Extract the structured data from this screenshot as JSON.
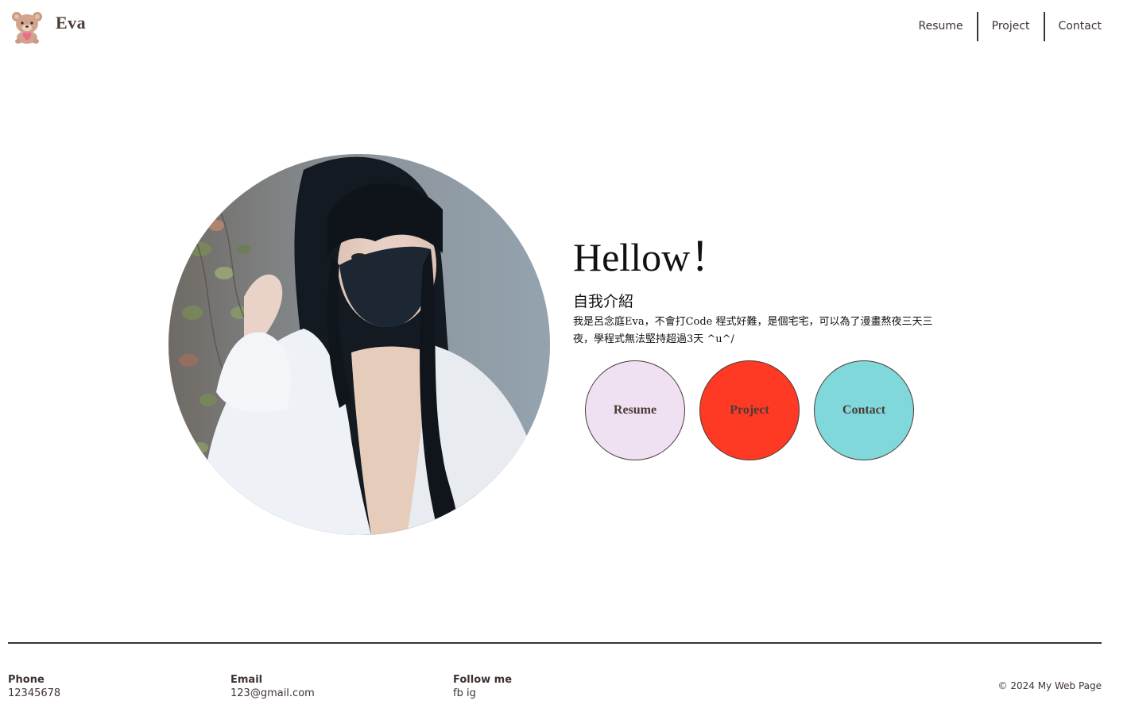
{
  "header": {
    "brand": "Eva",
    "logo_icon": "teddy-bear-icon",
    "nav": [
      {
        "label": "Resume"
      },
      {
        "label": "Project"
      },
      {
        "label": "Contact"
      }
    ]
  },
  "hero": {
    "photo_icon": "profile-photo",
    "greeting": "Hellow！",
    "intro_title": "自我介紹",
    "intro_text": "我是呂念庭Eva，不會打Code 程式好難，是個宅宅，可以為了漫畫熬夜三天三夜，學程式無法堅持超過3天 ^u^/",
    "buttons": [
      {
        "label": "Resume",
        "color": "#efe1f2"
      },
      {
        "label": "Project",
        "color": "#ff3a24"
      },
      {
        "label": "Contact",
        "color": "#80d8da"
      }
    ]
  },
  "footer": {
    "phone_label": "Phone",
    "phone_value": "12345678",
    "email_label": "Email",
    "email_value": "123@gmail.com",
    "follow_label": "Follow me",
    "follow_value": "fb ig",
    "copyright": "© 2024 My Web Page"
  },
  "colors": {
    "text": "#3e3430",
    "background": "#ffffff"
  }
}
